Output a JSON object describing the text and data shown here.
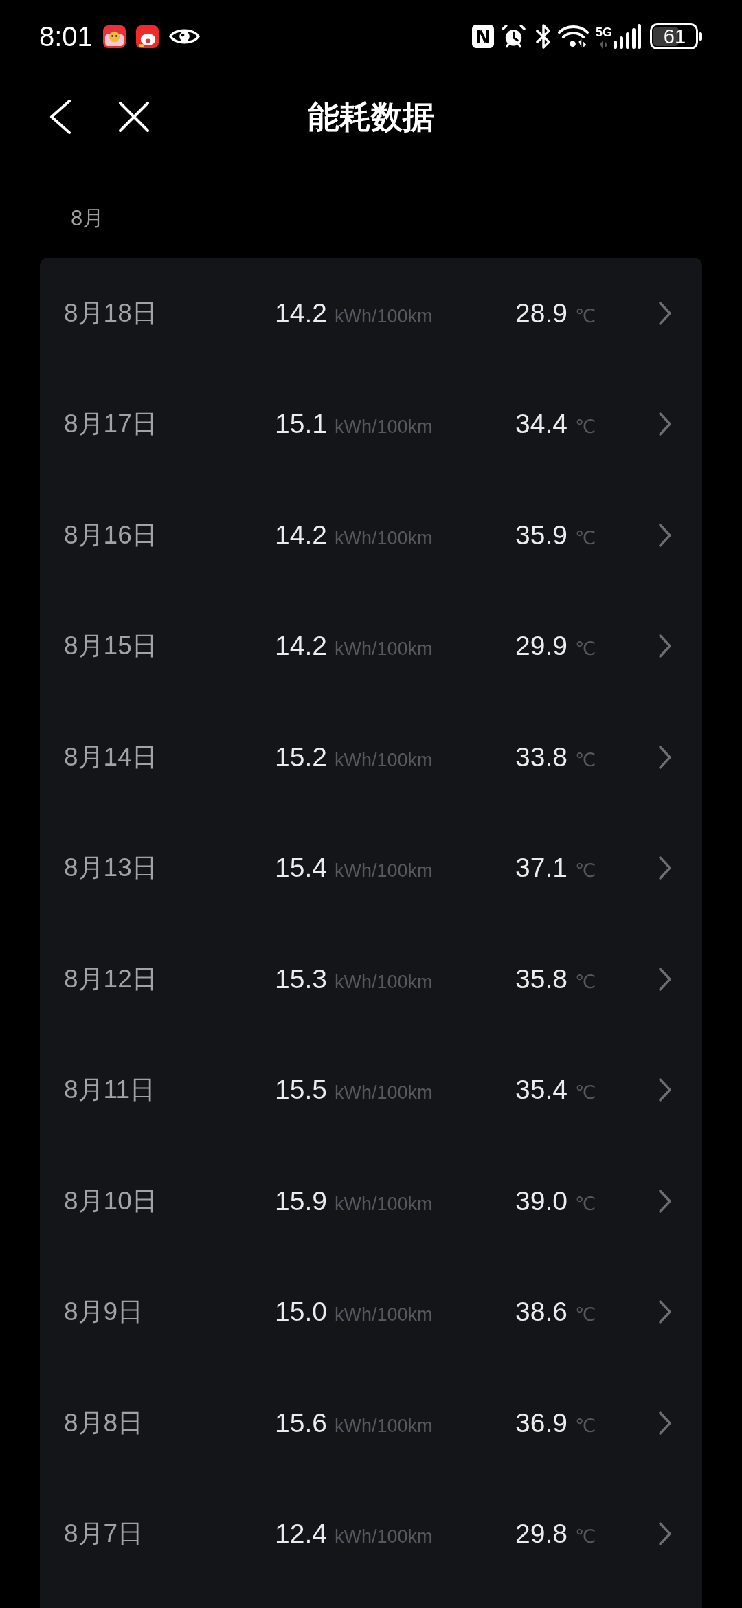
{
  "status_bar": {
    "time": "8:01",
    "network": "5G",
    "battery": "61"
  },
  "header": {
    "title": "能耗数据"
  },
  "section": {
    "label": "8月"
  },
  "records": [
    {
      "date": "8月18日",
      "consumption": "14.2",
      "consumption_unit": "kWh/100km",
      "temperature": "28.9",
      "temperature_unit": "℃"
    },
    {
      "date": "8月17日",
      "consumption": "15.1",
      "consumption_unit": "kWh/100km",
      "temperature": "34.4",
      "temperature_unit": "℃"
    },
    {
      "date": "8月16日",
      "consumption": "14.2",
      "consumption_unit": "kWh/100km",
      "temperature": "35.9",
      "temperature_unit": "℃"
    },
    {
      "date": "8月15日",
      "consumption": "14.2",
      "consumption_unit": "kWh/100km",
      "temperature": "29.9",
      "temperature_unit": "℃"
    },
    {
      "date": "8月14日",
      "consumption": "15.2",
      "consumption_unit": "kWh/100km",
      "temperature": "33.8",
      "temperature_unit": "℃"
    },
    {
      "date": "8月13日",
      "consumption": "15.4",
      "consumption_unit": "kWh/100km",
      "temperature": "37.1",
      "temperature_unit": "℃"
    },
    {
      "date": "8月12日",
      "consumption": "15.3",
      "consumption_unit": "kWh/100km",
      "temperature": "35.8",
      "temperature_unit": "℃"
    },
    {
      "date": "8月11日",
      "consumption": "15.5",
      "consumption_unit": "kWh/100km",
      "temperature": "35.4",
      "temperature_unit": "℃"
    },
    {
      "date": "8月10日",
      "consumption": "15.9",
      "consumption_unit": "kWh/100km",
      "temperature": "39.0",
      "temperature_unit": "℃"
    },
    {
      "date": "8月9日",
      "consumption": "15.0",
      "consumption_unit": "kWh/100km",
      "temperature": "38.6",
      "temperature_unit": "℃"
    },
    {
      "date": "8月8日",
      "consumption": "15.6",
      "consumption_unit": "kWh/100km",
      "temperature": "36.9",
      "temperature_unit": "℃"
    },
    {
      "date": "8月7日",
      "consumption": "12.4",
      "consumption_unit": "kWh/100km",
      "temperature": "29.8",
      "temperature_unit": "℃"
    }
  ]
}
